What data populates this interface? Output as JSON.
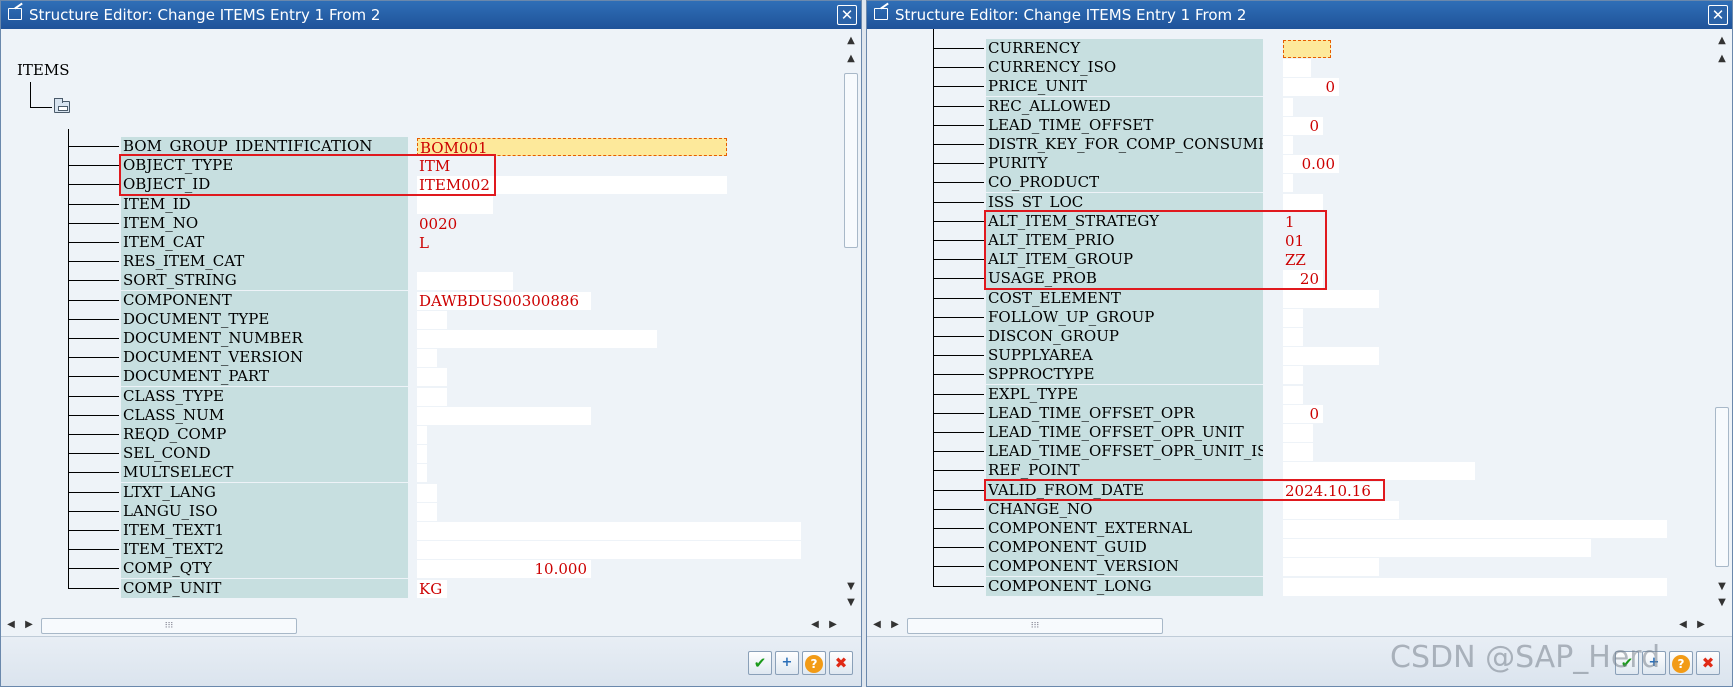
{
  "left_window": {
    "title": "Structure Editor: Change ITEMS Entry 1 From 2",
    "root_label": "ITEMS",
    "fields": [
      {
        "name": "BOM_GROUP_IDENTIFICATION",
        "value": "BOM001"
      },
      {
        "name": "OBJECT_TYPE",
        "value": "ITM"
      },
      {
        "name": "OBJECT_ID",
        "value": "ITEM002"
      },
      {
        "name": "ITEM_ID",
        "value": ""
      },
      {
        "name": "ITEM_NO",
        "value": "0020"
      },
      {
        "name": "ITEM_CAT",
        "value": "L"
      },
      {
        "name": "RES_ITEM_CAT",
        "value": ""
      },
      {
        "name": "SORT_STRING",
        "value": ""
      },
      {
        "name": "COMPONENT",
        "value": "DAWBDUS00300886"
      },
      {
        "name": "DOCUMENT_TYPE",
        "value": ""
      },
      {
        "name": "DOCUMENT_NUMBER",
        "value": ""
      },
      {
        "name": "DOCUMENT_VERSION",
        "value": ""
      },
      {
        "name": "DOCUMENT_PART",
        "value": ""
      },
      {
        "name": "CLASS_TYPE",
        "value": ""
      },
      {
        "name": "CLASS_NUM",
        "value": ""
      },
      {
        "name": "REQD_COMP",
        "value": ""
      },
      {
        "name": "SEL_COND",
        "value": ""
      },
      {
        "name": "MULTSELECT",
        "value": ""
      },
      {
        "name": "LTXT_LANG",
        "value": ""
      },
      {
        "name": "LANGU_ISO",
        "value": ""
      },
      {
        "name": "ITEM_TEXT1",
        "value": ""
      },
      {
        "name": "ITEM_TEXT2",
        "value": ""
      },
      {
        "name": "COMP_QTY",
        "value": "10.000"
      },
      {
        "name": "COMP_UNIT",
        "value": "KG"
      }
    ]
  },
  "right_window": {
    "title": "Structure Editor: Change ITEMS Entry 1 From 2",
    "fields": [
      {
        "name": "CURRENCY",
        "value": ""
      },
      {
        "name": "CURRENCY_ISO",
        "value": ""
      },
      {
        "name": "PRICE_UNIT",
        "value": "0"
      },
      {
        "name": "REC_ALLOWED",
        "value": ""
      },
      {
        "name": "LEAD_TIME_OFFSET",
        "value": "0"
      },
      {
        "name": "DISTR_KEY_FOR_COMP_CONSUMPTION",
        "value": ""
      },
      {
        "name": "PURITY",
        "value": "0.00"
      },
      {
        "name": "CO_PRODUCT",
        "value": ""
      },
      {
        "name": "ISS_ST_LOC",
        "value": ""
      },
      {
        "name": "ALT_ITEM_STRATEGY",
        "value": "1"
      },
      {
        "name": "ALT_ITEM_PRIO",
        "value": "01"
      },
      {
        "name": "ALT_ITEM_GROUP",
        "value": "ZZ"
      },
      {
        "name": "USAGE_PROB",
        "value": "20"
      },
      {
        "name": "COST_ELEMENT",
        "value": ""
      },
      {
        "name": "FOLLOW_UP_GROUP",
        "value": ""
      },
      {
        "name": "DISCON_GROUP",
        "value": ""
      },
      {
        "name": "SUPPLYAREA",
        "value": ""
      },
      {
        "name": "SPPROCTYPE",
        "value": ""
      },
      {
        "name": "EXPL_TYPE",
        "value": ""
      },
      {
        "name": "LEAD_TIME_OFFSET_OPR",
        "value": "0"
      },
      {
        "name": "LEAD_TIME_OFFSET_OPR_UNIT",
        "value": ""
      },
      {
        "name": "LEAD_TIME_OFFSET_OPR_UNIT_ISO",
        "value": ""
      },
      {
        "name": "REF_POINT",
        "value": ""
      },
      {
        "name": "VALID_FROM_DATE",
        "value": "2024.10.16"
      },
      {
        "name": "CHANGE_NO",
        "value": ""
      },
      {
        "name": "COMPONENT_EXTERNAL",
        "value": ""
      },
      {
        "name": "COMPONENT_GUID",
        "value": ""
      },
      {
        "name": "COMPONENT_VERSION",
        "value": ""
      },
      {
        "name": "COMPONENT_LONG",
        "value": ""
      }
    ]
  },
  "icons": {
    "close": "close-icon",
    "confirm": "checkmark-icon",
    "new_entry": "new-entry-icon",
    "help": "help-icon",
    "cancel": "cancel-icon",
    "folder": "folder-icon"
  },
  "glyphs": {
    "close": "✕",
    "confirm": "✔",
    "new_entry": "+",
    "help": "?",
    "cancel": "✖",
    "up": "▲",
    "down": "▼",
    "left": "◀",
    "right": "▶",
    "grip_v": "⁞",
    "grip_h": "⁝⁝⁝"
  },
  "colors": {
    "title_bar": "#2f6fb7",
    "field_label_bg": "#c7dfe0",
    "value_text": "#cc0000",
    "focused_bg": "#fde99b",
    "highlight_box": "#e0191e"
  },
  "watermark": "CSDN @SAP_Herd"
}
